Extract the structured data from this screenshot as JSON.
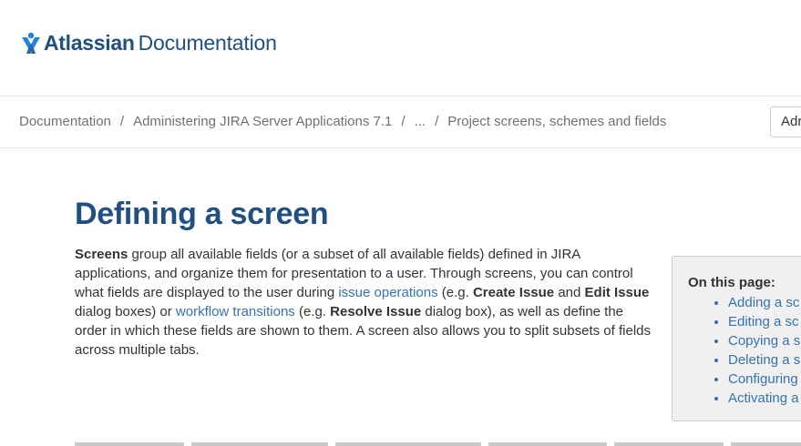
{
  "header": {
    "logo_brand": "Atlassian",
    "logo_suffix": "Documentation",
    "logo_icon": "atlassian-logo-icon",
    "brand_color": "#205081"
  },
  "breadcrumb": {
    "items": [
      "Documentation",
      "Administering JIRA Server Applications 7.1",
      "...",
      "Project screens, schemes and fields"
    ],
    "separator": "/",
    "button_label": "Adr"
  },
  "main": {
    "title": "Defining a screen",
    "intro": {
      "t1": "Screens",
      "t2": " group all available fields (or a subset of all available fields) defined in JIRA applications, and organize them for presentation to a user. Through screens, you can control what fields are displayed to the user during ",
      "link1": "issue operations",
      "t3": " (e.g. ",
      "b1": "Create Issue",
      "t4": " and ",
      "b2": "Edit Issue",
      "t5": " dialog boxes) or ",
      "link2": "workflow transitions",
      "t6": " (e.g. ",
      "b3": "Resolve Issue",
      "t7": " dialog box), as well as define the order in which these fields are shown to them. A screen also allows you to split subsets of fields across multiple tabs."
    },
    "link_color": "#3572b0"
  },
  "toc": {
    "title": "On this page:",
    "items": [
      "Adding a sc",
      "Editing a sc",
      "Copying a s",
      "Deleting a s",
      "Configuring",
      "Activating a"
    ]
  }
}
